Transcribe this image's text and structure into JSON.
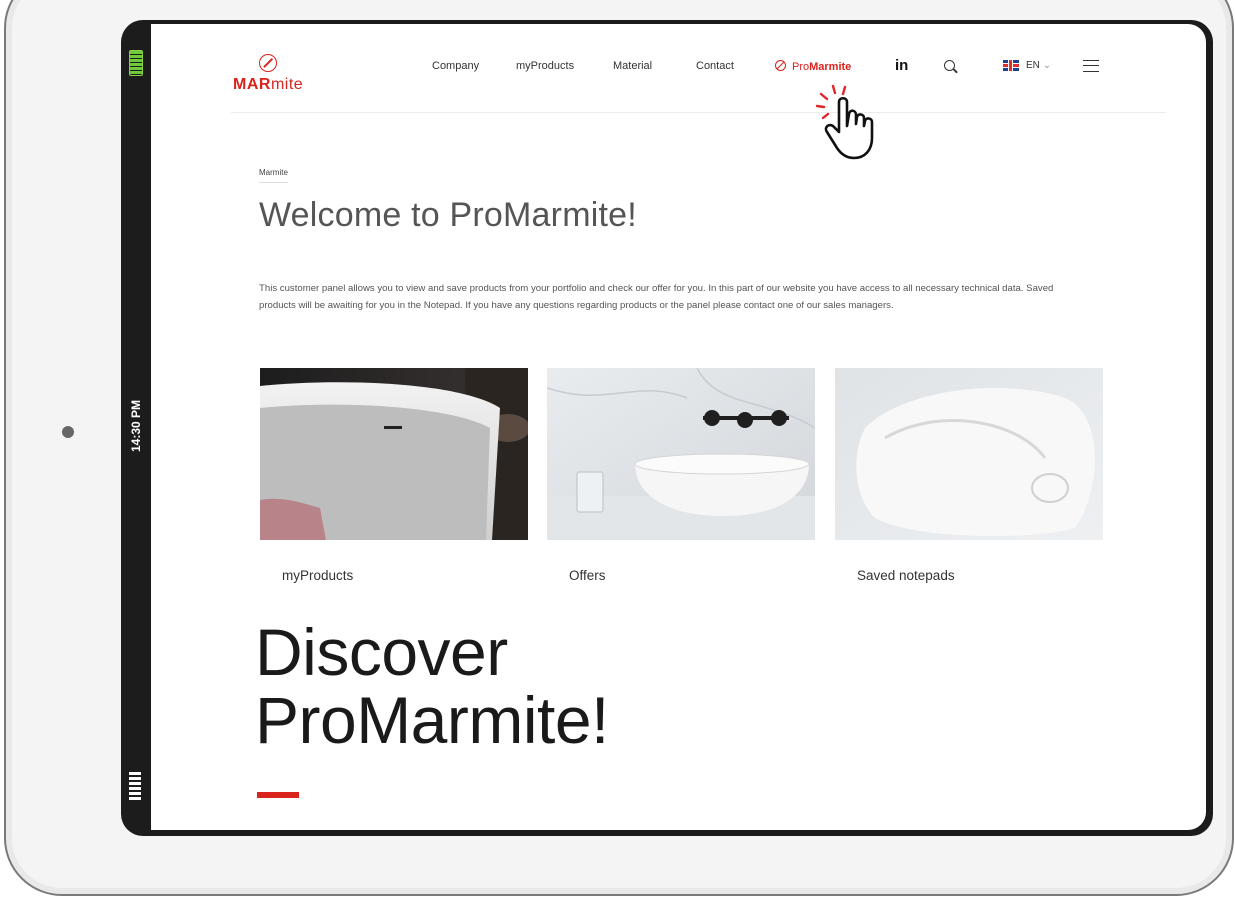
{
  "status": {
    "time": "14:30 PM"
  },
  "header": {
    "logo": {
      "text_bold": "MAR",
      "text_light": "mite"
    },
    "nav": [
      {
        "label": "Company"
      },
      {
        "label": "myProducts"
      },
      {
        "label": "Material"
      },
      {
        "label": "Contact"
      }
    ],
    "pro_link": {
      "prefix": "Pro",
      "bold": "Marmite",
      "color": "#d9231d"
    },
    "social_label": "in",
    "language": "EN",
    "language_arrow": "⌄"
  },
  "breadcrumb": "Marmite",
  "page_title": "Welcome to ProMarmite!",
  "intro_text": "This customer panel allows you to view and save products from your portfolio and check our offer for you. In this part of our website you have access to all necessary technical data. Saved products will be awaiting for you in the Notepad. If you have any questions regarding products or the panel please contact one of our sales managers.",
  "cards": [
    {
      "label": "myProducts"
    },
    {
      "label": "Offers"
    },
    {
      "label": "Saved notepads"
    }
  ],
  "hero": {
    "line1": "Discover",
    "line2": "ProMarmite!"
  },
  "colors": {
    "accent": "#d9231d",
    "text": "#333333"
  }
}
